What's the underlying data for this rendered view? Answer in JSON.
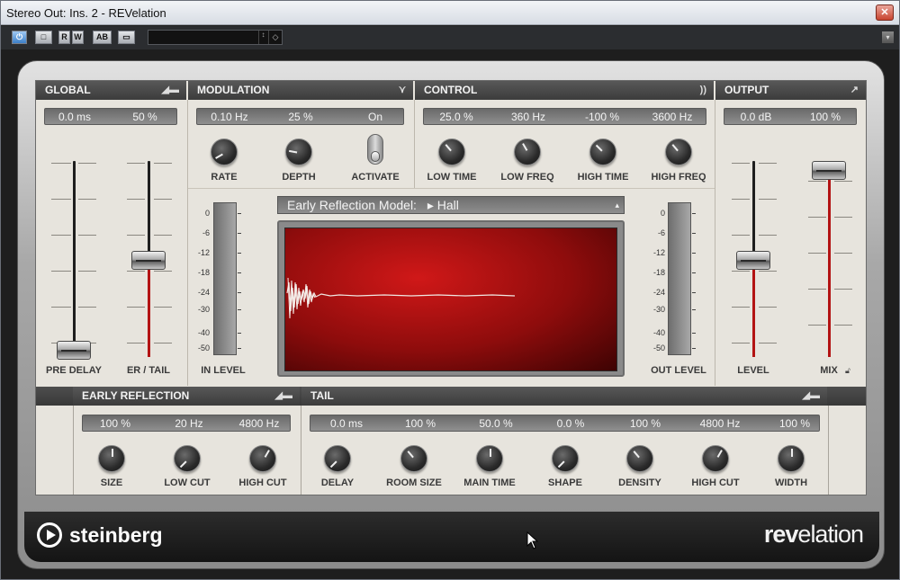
{
  "window": {
    "title": "Stereo Out: Ins. 2 - REVelation",
    "close_icon": "close-icon"
  },
  "toolbar": {
    "power": "⏻",
    "bypass": "□",
    "read": "R",
    "write": "W",
    "ab": "AB",
    "compare": "▭",
    "preset_value": "",
    "preset_arrows": "↕",
    "preset_menu": "◇",
    "options": "▾"
  },
  "global": {
    "header": "GLOBAL",
    "pre_delay_value": "0.0 ms",
    "er_tail_value": "50 %",
    "pre_delay_label": "PRE DELAY",
    "er_tail_label": "ER / TAIL",
    "pre_delay_level": 0.0,
    "er_tail_level": 0.5
  },
  "modulation": {
    "header": "MODULATION",
    "rate_value": "0.10 Hz",
    "depth_value": "25 %",
    "activate_value": "On",
    "rate_label": "RATE",
    "depth_label": "DEPTH",
    "activate_label": "ACTIVATE"
  },
  "control": {
    "header": "CONTROL",
    "values": [
      "25.0 %",
      "360 Hz",
      "-100 %",
      "3600 Hz"
    ],
    "labels": [
      "LOW TIME",
      "LOW FREQ",
      "HIGH TIME",
      "HIGH FREQ"
    ]
  },
  "output": {
    "header": "OUTPUT",
    "level_value": "0.0 dB",
    "mix_value": "100 %",
    "level_label": "LEVEL",
    "mix_label": "MIX",
    "level_position": 0.5,
    "mix_position": 1.0
  },
  "meters": {
    "in_label": "IN LEVEL",
    "out_label": "OUT LEVEL",
    "scale": [
      "0",
      "-6",
      "-12",
      "-18",
      "-24",
      "-30",
      "-40",
      "-50"
    ]
  },
  "display": {
    "model_label": "Early Reflection Model:",
    "model_value": "Hall"
  },
  "early_reflection": {
    "header": "EARLY REFLECTION",
    "values": [
      "100 %",
      "20 Hz",
      "4800 Hz"
    ],
    "labels": [
      "SIZE",
      "LOW CUT",
      "HIGH CUT"
    ]
  },
  "tail": {
    "header": "TAIL",
    "values": [
      "0.0 ms",
      "100 %",
      "50.0 %",
      "0.0 %",
      "100 %",
      "4800 Hz",
      "100 %"
    ],
    "labels": [
      "DELAY",
      "ROOM SIZE",
      "MAIN TIME",
      "SHAPE",
      "DENSITY",
      "HIGH CUT",
      "WIDTH"
    ]
  },
  "footer": {
    "brand": "steinberg",
    "product_bold": "rev",
    "product_rest": "elation"
  }
}
